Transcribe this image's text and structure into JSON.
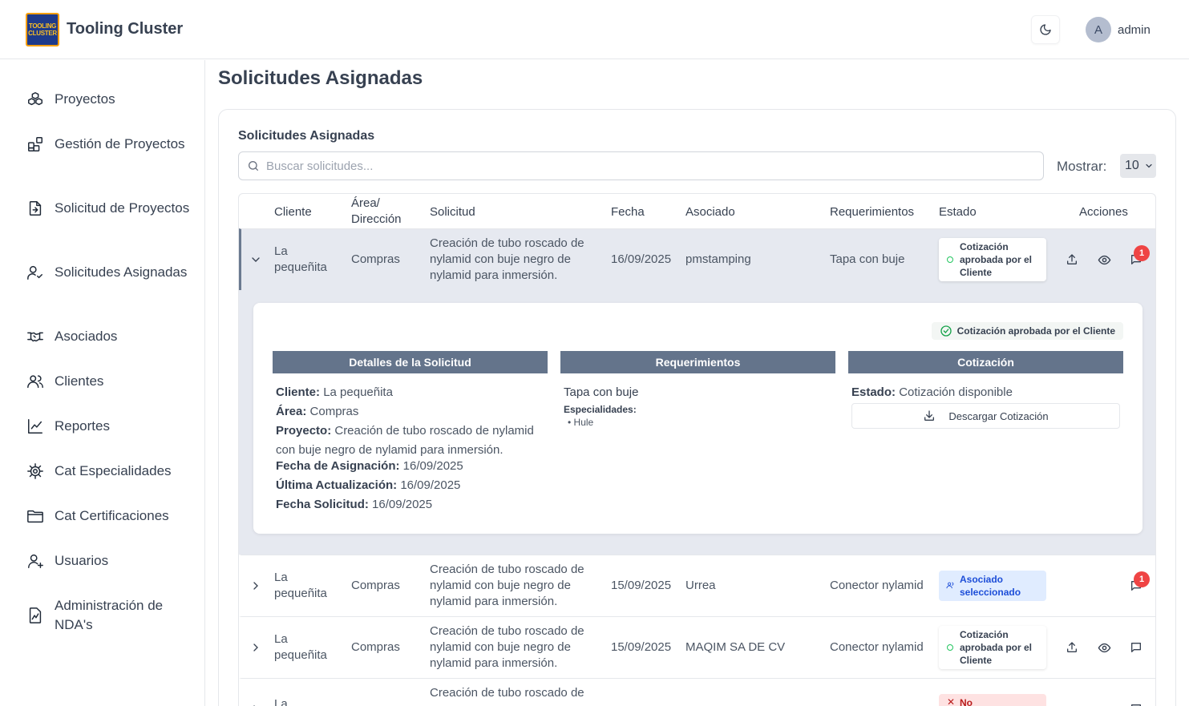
{
  "header": {
    "logo_text": "TOOLING CLUSTER",
    "brand": "Tooling Cluster",
    "avatar_initial": "A",
    "username": "admin"
  },
  "sidebar": {
    "items": [
      {
        "label": "Proyectos",
        "icon": "boxes-icon"
      },
      {
        "label": "Gestión de Proyectos",
        "icon": "layout-blocks-icon"
      },
      {
        "label": "Solicitud de Proyectos",
        "icon": "file-arrow-icon"
      },
      {
        "label": "Solicitudes Asignadas",
        "icon": "user-check-icon"
      },
      {
        "label": "Asociados",
        "icon": "handshake-icon"
      },
      {
        "label": "Clientes",
        "icon": "users-icon"
      },
      {
        "label": "Reportes",
        "icon": "line-chart-icon"
      },
      {
        "label": "Cat Especialidades",
        "icon": "cog-icon"
      },
      {
        "label": "Cat Certificaciones",
        "icon": "folder-icon"
      },
      {
        "label": "Usuarios",
        "icon": "user-plus-icon"
      },
      {
        "label": "Administración de NDA's",
        "icon": "file-signature-icon"
      }
    ]
  },
  "page": {
    "title": "Solicitudes Asignadas",
    "card_title": "Solicitudes Asignadas",
    "search_placeholder": "Buscar solicitudes...",
    "show_label": "Mostrar:",
    "show_value": "10"
  },
  "table": {
    "headers": {
      "cliente": "Cliente",
      "area_1": "Área/",
      "area_2": "Dirección",
      "solicitud": "Solicitud",
      "fecha": "Fecha",
      "asociado": "Asociado",
      "requerimientos": "Requerimientos",
      "estado": "Estado",
      "acciones": "Acciones"
    },
    "rows": [
      {
        "cliente_1": "La",
        "cliente_2": "pequeñita",
        "area": "Compras",
        "sol_1": "Creación de tubo roscado de",
        "sol_2": "nylamid con buje negro de",
        "sol_3": "nylamid para inmersión.",
        "fecha": "16/09/2025",
        "asociado": "pmstamping",
        "req": "Tapa con buje",
        "estado_1": "Cotización",
        "estado_2": "aprobada por el",
        "estado_3": "Cliente",
        "notif": "1"
      },
      {
        "cliente_1": "La",
        "cliente_2": "pequeñita",
        "area": "Compras",
        "sol_1": "Creación de tubo roscado de",
        "sol_2": "nylamid con buje negro de",
        "sol_3": "nylamid para inmersión.",
        "fecha": "15/09/2025",
        "asociado": "Urrea",
        "req": "Conector nylamid",
        "estado_1": "Asociado",
        "estado_2": "seleccionado",
        "notif": "1"
      },
      {
        "cliente_1": "La",
        "cliente_2": "pequeñita",
        "area": "Compras",
        "sol_1": "Creación de tubo roscado de",
        "sol_2": "nylamid con buje negro de",
        "sol_3": "nylamid para inmersión.",
        "fecha": "15/09/2025",
        "asociado": "MAQIM SA DE CV",
        "req": "Conector nylamid",
        "estado_1": "Cotización",
        "estado_2": "aprobada por el",
        "estado_3": "Cliente"
      },
      {
        "cliente_1": "La",
        "sol_1": "Creación de tubo roscado de",
        "estado_1": "No"
      }
    ]
  },
  "details": {
    "status_badge": "Cotización aprobada por el Cliente",
    "sections": {
      "detalles": "Detalles de la Solicitud",
      "requerimientos": "Requerimientos",
      "cotizacion": "Cotización"
    },
    "cliente_label": "Cliente:",
    "cliente": "La pequeñita",
    "area_label": "Área:",
    "area": "Compras",
    "proyecto_label": "Proyecto:",
    "proyecto_1": "Creación de tubo roscado de nylamid",
    "proyecto_2": "con buje negro de nylamid para inmersión.",
    "fecha_asig_label": "Fecha de Asignación:",
    "fecha_asig": "16/09/2025",
    "ultima_label": "Última Actualización:",
    "ultima": "16/09/2025",
    "fecha_sol_label": "Fecha Solicitud:",
    "fecha_sol": "16/09/2025",
    "req_name": "Tapa con buje",
    "especialidades_label": "Especialidades:",
    "especialidad": "Hule",
    "estado_label": "Estado:",
    "estado": "Cotización disponible",
    "download_label": "Descargar Cotización"
  }
}
